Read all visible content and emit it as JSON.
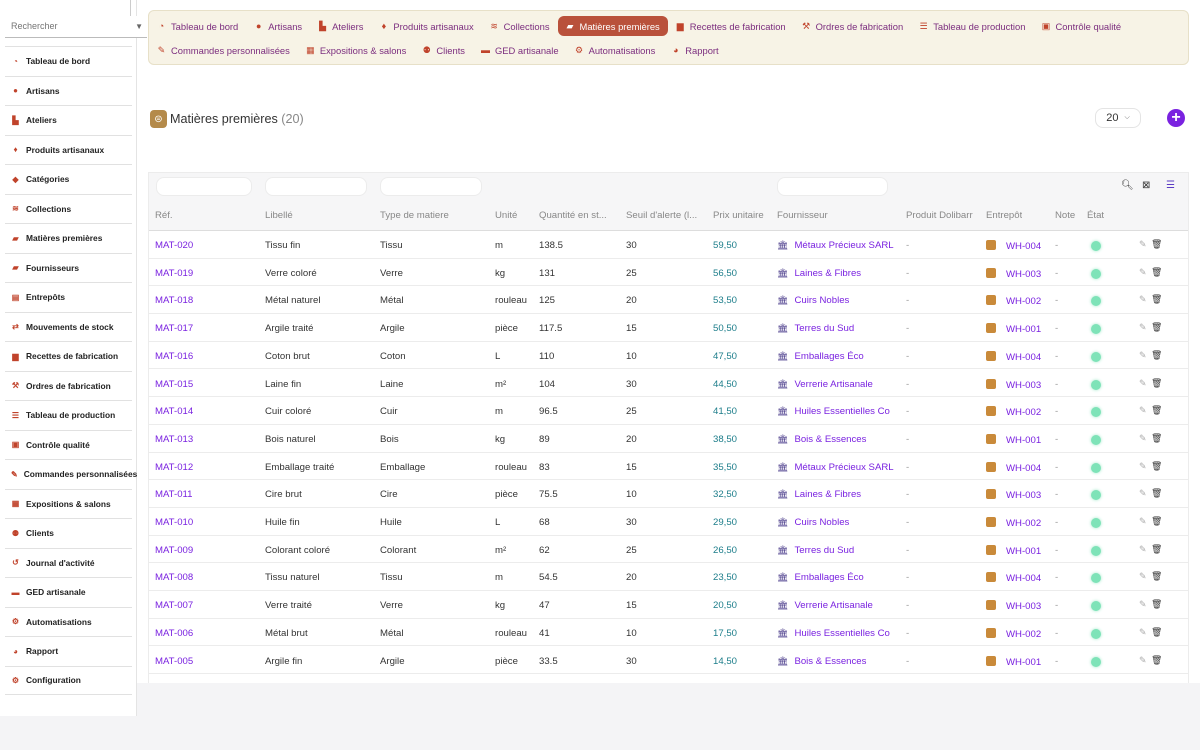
{
  "search": {
    "placeholder": "Rechercher"
  },
  "sidebar": {
    "items": [
      {
        "label": "Tableau de bord",
        "icon": "gauge-icon"
      },
      {
        "label": "Artisans",
        "icon": "user-icon"
      },
      {
        "label": "Ateliers",
        "icon": "factory-icon"
      },
      {
        "label": "Produits artisanaux",
        "icon": "gem-icon"
      },
      {
        "label": "Catégories",
        "icon": "tags-icon"
      },
      {
        "label": "Collections",
        "icon": "layers-icon"
      },
      {
        "label": "Matières premières",
        "icon": "truck-icon"
      },
      {
        "label": "Fournisseurs",
        "icon": "truck-icon"
      },
      {
        "label": "Entrepôts",
        "icon": "warehouse-icon"
      },
      {
        "label": "Mouvements de stock",
        "icon": "exchange-icon"
      },
      {
        "label": "Recettes de fabrication",
        "icon": "recipe-icon"
      },
      {
        "label": "Ordres de fabrication",
        "icon": "hammer-icon"
      },
      {
        "label": "Tableau de production",
        "icon": "list-icon"
      },
      {
        "label": "Contrôle qualité",
        "icon": "clipboard-icon"
      },
      {
        "label": "Commandes personnalisées",
        "icon": "pencil-icon"
      },
      {
        "label": "Expositions & salons",
        "icon": "store-icon"
      },
      {
        "label": "Clients",
        "icon": "users-icon"
      },
      {
        "label": "Journal d'activité",
        "icon": "history-icon"
      },
      {
        "label": "GED artisanale",
        "icon": "folder-icon"
      },
      {
        "label": "Automatisations",
        "icon": "robot-icon"
      },
      {
        "label": "Rapport",
        "icon": "pie-chart-icon"
      },
      {
        "label": "Configuration",
        "icon": "gear-icon"
      }
    ]
  },
  "nav": {
    "row1": [
      {
        "label": "Tableau de bord",
        "icon": "gauge-icon",
        "active": false
      },
      {
        "label": "Artisans",
        "icon": "user-icon",
        "active": false
      },
      {
        "label": "Ateliers",
        "icon": "factory-icon",
        "active": false
      },
      {
        "label": "Produits artisanaux",
        "icon": "gem-icon",
        "active": false
      },
      {
        "label": "Collections",
        "icon": "layers-icon",
        "active": false
      },
      {
        "label": "Matières premières",
        "icon": "truck-icon",
        "active": true
      },
      {
        "label": "Recettes de fabrication",
        "icon": "recipe-icon",
        "active": false
      },
      {
        "label": "Ordres de fabrication",
        "icon": "hammer-icon",
        "active": false
      },
      {
        "label": "Tableau de production",
        "icon": "list-icon",
        "active": false
      },
      {
        "label": "Contrôle qualité",
        "icon": "clipboard-icon",
        "active": false
      }
    ],
    "row2": [
      {
        "label": "Commandes personnalisées",
        "icon": "pencil-icon",
        "active": false
      },
      {
        "label": "Expositions & salons",
        "icon": "store-icon",
        "active": false
      },
      {
        "label": "Clients",
        "icon": "users-icon",
        "active": false
      },
      {
        "label": "GED artisanale",
        "icon": "folder-icon",
        "active": false
      },
      {
        "label": "Automatisations",
        "icon": "robot-icon",
        "active": false
      },
      {
        "label": "Rapport",
        "icon": "pie-chart-icon",
        "active": false
      }
    ]
  },
  "page": {
    "title": "Matières premières",
    "count": "(20)",
    "limit": "20"
  },
  "table": {
    "columns": [
      "Réf.",
      "Libellé",
      "Type de matiere",
      "Unité",
      "Quantité en st...",
      "Seuil d'alerte (l...",
      "Prix unitaire",
      "Fournisseur",
      "Produit Dolibarr",
      "Entrepôt",
      "Note",
      "État"
    ],
    "rows": [
      {
        "ref": "MAT-020",
        "label": "Tissu fin",
        "type": "Tissu",
        "unit": "m",
        "qty": "138.5",
        "threshold": "30",
        "price": "59,50",
        "supplier": "Métaux Précieux SARL",
        "product": "-",
        "warehouse": "WH-004",
        "note": "-"
      },
      {
        "ref": "MAT-019",
        "label": "Verre coloré",
        "type": "Verre",
        "unit": "kg",
        "qty": "131",
        "threshold": "25",
        "price": "56,50",
        "supplier": "Laines & Fibres",
        "product": "-",
        "warehouse": "WH-003",
        "note": "-"
      },
      {
        "ref": "MAT-018",
        "label": "Métal naturel",
        "type": "Métal",
        "unit": "rouleau",
        "qty": "125",
        "threshold": "20",
        "price": "53,50",
        "supplier": "Cuirs Nobles",
        "product": "-",
        "warehouse": "WH-002",
        "note": "-"
      },
      {
        "ref": "MAT-017",
        "label": "Argile traité",
        "type": "Argile",
        "unit": "pièce",
        "qty": "117.5",
        "threshold": "15",
        "price": "50,50",
        "supplier": "Terres du Sud",
        "product": "-",
        "warehouse": "WH-001",
        "note": "-"
      },
      {
        "ref": "MAT-016",
        "label": "Coton brut",
        "type": "Coton",
        "unit": "L",
        "qty": "110",
        "threshold": "10",
        "price": "47,50",
        "supplier": "Emballages Éco",
        "product": "-",
        "warehouse": "WH-004",
        "note": "-"
      },
      {
        "ref": "MAT-015",
        "label": "Laine fin",
        "type": "Laine",
        "unit": "m²",
        "qty": "104",
        "threshold": "30",
        "price": "44,50",
        "supplier": "Verrerie Artisanale",
        "product": "-",
        "warehouse": "WH-003",
        "note": "-"
      },
      {
        "ref": "MAT-014",
        "label": "Cuir coloré",
        "type": "Cuir",
        "unit": "m",
        "qty": "96.5",
        "threshold": "25",
        "price": "41,50",
        "supplier": "Huiles Essentielles Co",
        "product": "-",
        "warehouse": "WH-002",
        "note": "-"
      },
      {
        "ref": "MAT-013",
        "label": "Bois naturel",
        "type": "Bois",
        "unit": "kg",
        "qty": "89",
        "threshold": "20",
        "price": "38,50",
        "supplier": "Bois & Essences",
        "product": "-",
        "warehouse": "WH-001",
        "note": "-"
      },
      {
        "ref": "MAT-012",
        "label": "Emballage traité",
        "type": "Emballage",
        "unit": "rouleau",
        "qty": "83",
        "threshold": "15",
        "price": "35,50",
        "supplier": "Métaux Précieux SARL",
        "product": "-",
        "warehouse": "WH-004",
        "note": "-"
      },
      {
        "ref": "MAT-011",
        "label": "Cire brut",
        "type": "Cire",
        "unit": "pièce",
        "qty": "75.5",
        "threshold": "10",
        "price": "32,50",
        "supplier": "Laines & Fibres",
        "product": "-",
        "warehouse": "WH-003",
        "note": "-"
      },
      {
        "ref": "MAT-010",
        "label": "Huile fin",
        "type": "Huile",
        "unit": "L",
        "qty": "68",
        "threshold": "30",
        "price": "29,50",
        "supplier": "Cuirs Nobles",
        "product": "-",
        "warehouse": "WH-002",
        "note": "-"
      },
      {
        "ref": "MAT-009",
        "label": "Colorant coloré",
        "type": "Colorant",
        "unit": "m²",
        "qty": "62",
        "threshold": "25",
        "price": "26,50",
        "supplier": "Terres du Sud",
        "product": "-",
        "warehouse": "WH-001",
        "note": "-"
      },
      {
        "ref": "MAT-008",
        "label": "Tissu naturel",
        "type": "Tissu",
        "unit": "m",
        "qty": "54.5",
        "threshold": "20",
        "price": "23,50",
        "supplier": "Emballages Éco",
        "product": "-",
        "warehouse": "WH-004",
        "note": "-"
      },
      {
        "ref": "MAT-007",
        "label": "Verre traité",
        "type": "Verre",
        "unit": "kg",
        "qty": "47",
        "threshold": "15",
        "price": "20,50",
        "supplier": "Verrerie Artisanale",
        "product": "-",
        "warehouse": "WH-003",
        "note": "-"
      },
      {
        "ref": "MAT-006",
        "label": "Métal brut",
        "type": "Métal",
        "unit": "rouleau",
        "qty": "41",
        "threshold": "10",
        "price": "17,50",
        "supplier": "Huiles Essentielles Co",
        "product": "-",
        "warehouse": "WH-002",
        "note": "-"
      },
      {
        "ref": "MAT-005",
        "label": "Argile fin",
        "type": "Argile",
        "unit": "pièce",
        "qty": "33.5",
        "threshold": "30",
        "price": "14,50",
        "supplier": "Bois & Essences",
        "product": "-",
        "warehouse": "WH-001",
        "note": "-"
      }
    ]
  },
  "colors": {
    "accent": "#7a22e0",
    "active_tab": "#b9513b",
    "nav_text": "#7b2d7e",
    "icon": "#c0432b",
    "price": "#1c7d8a",
    "status": "#7ee3b8"
  }
}
